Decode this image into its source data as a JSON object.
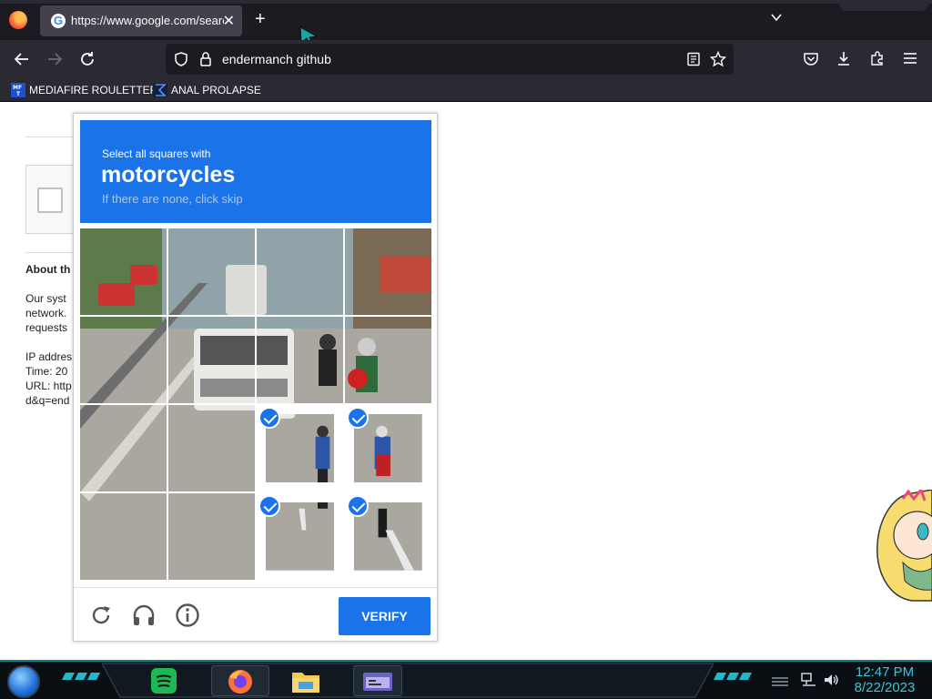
{
  "browser": {
    "tab_title": "https://www.google.com/searc",
    "tab_close": "✕",
    "new_tab": "+",
    "url_text": "endermanch github",
    "bookmarks": [
      {
        "label": "MEDIAFIRE ROULETTER",
        "icon": "mediafire-icon"
      },
      {
        "label": "ANAL PROLAPSE",
        "icon": "sigma-bookmark-icon"
      }
    ]
  },
  "page": {
    "about_heading": "About th",
    "body_lines": [
      "Our syst",
      "network.",
      "requests"
    ],
    "info_lines": [
      "IP addres",
      "Time: 20",
      "URL: http",
      "d&q=end"
    ]
  },
  "captcha": {
    "prompt_small": "Select all squares with",
    "prompt_target": "motorcycles",
    "prompt_hint": "If there are none, click skip",
    "selected_cells": [
      10,
      11,
      14,
      15
    ],
    "verify_label": "VERIFY",
    "accent_color": "#1a73e8"
  },
  "taskbar": {
    "time": "12:47 PM",
    "date": "8/22/2023",
    "apps": [
      "spotify-icon",
      "firefox-icon",
      "file-explorer-icon",
      "window-app-icon"
    ]
  }
}
